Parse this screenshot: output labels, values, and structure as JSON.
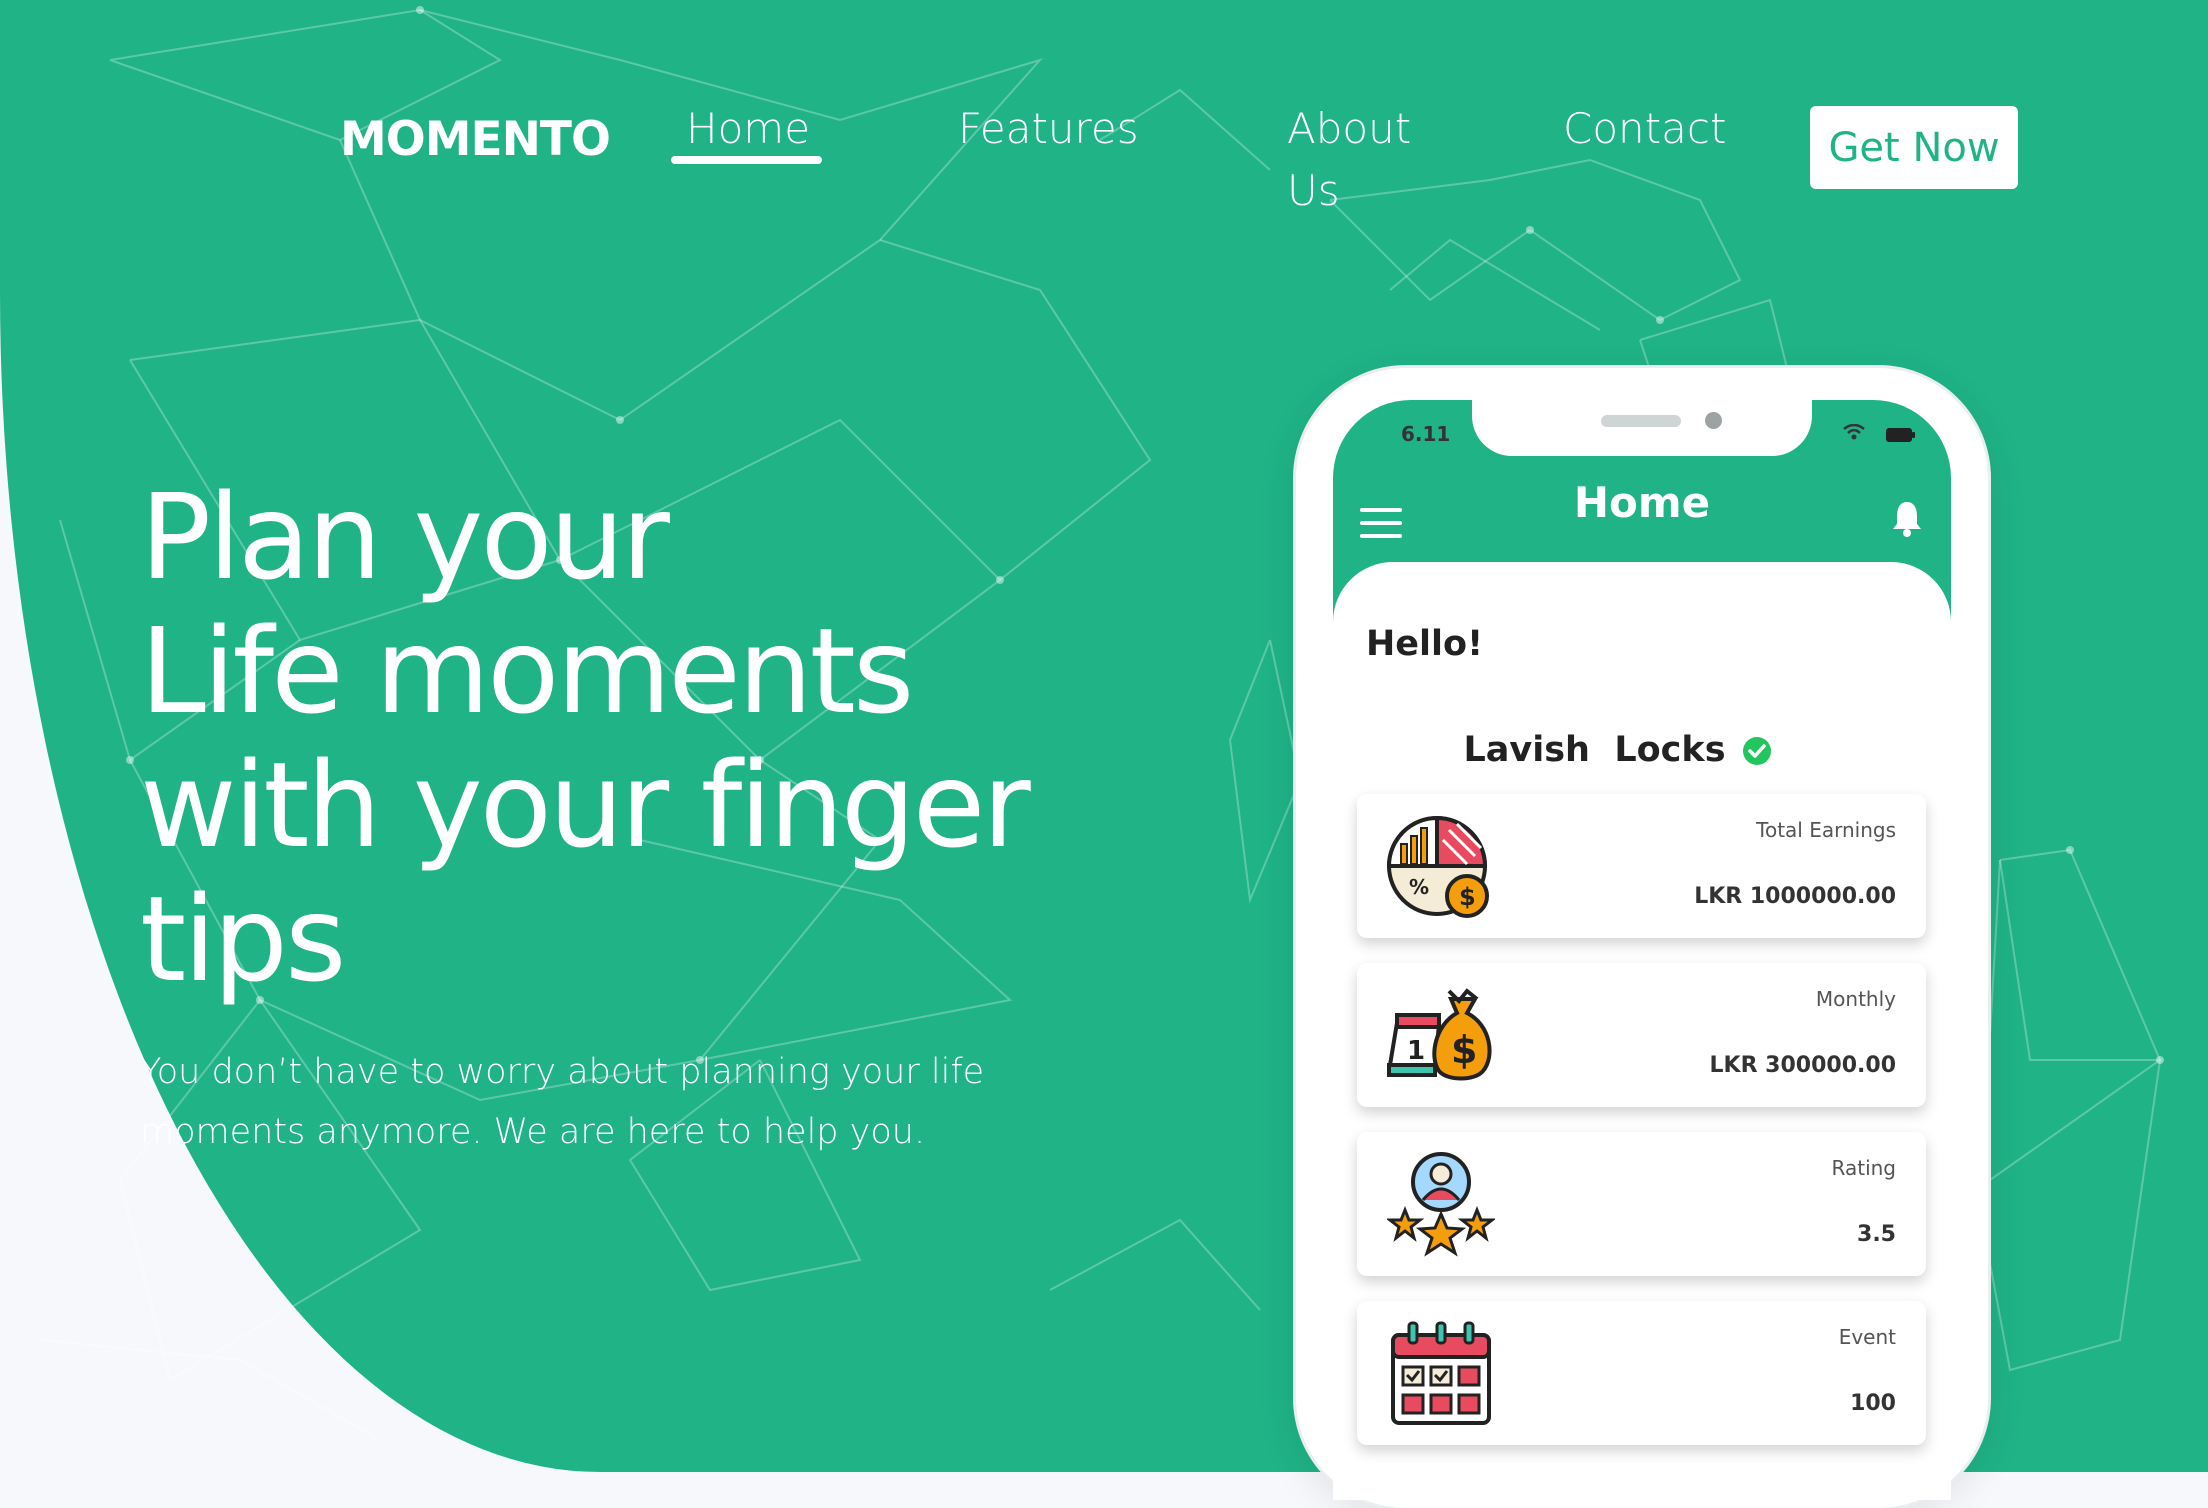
{
  "brand": {
    "logo": "MOMENTO"
  },
  "nav": {
    "home": "Home",
    "features": "Features",
    "about": "About Us",
    "contact": "Contact",
    "cta": "Get Now"
  },
  "hero": {
    "headline_1": "Plan your",
    "headline_2": "Life moments",
    "headline_3": "with your finger",
    "headline_4": "tips",
    "subtext": "You don’t have to worry about planning your life moments anymore. We are here to help you."
  },
  "phone": {
    "status_time": "6.11",
    "screen_title": "Home",
    "greeting": "Hello!",
    "user_name": "Lavish  Locks",
    "cards": [
      {
        "label": "Total Earnings",
        "value": "LKR 1000000.00",
        "icon": "earnings-chart-icon"
      },
      {
        "label": "Monthly",
        "value": "LKR 300000.00",
        "icon": "money-bag-calendar-icon"
      },
      {
        "label": "Rating",
        "value": "3.5",
        "icon": "user-rating-stars-icon"
      },
      {
        "label": "Event",
        "value": "100",
        "icon": "event-calendar-icon"
      }
    ]
  },
  "colors": {
    "primary": "#1fb386",
    "background": "#f6f8fb",
    "verified": "#22c55e"
  }
}
